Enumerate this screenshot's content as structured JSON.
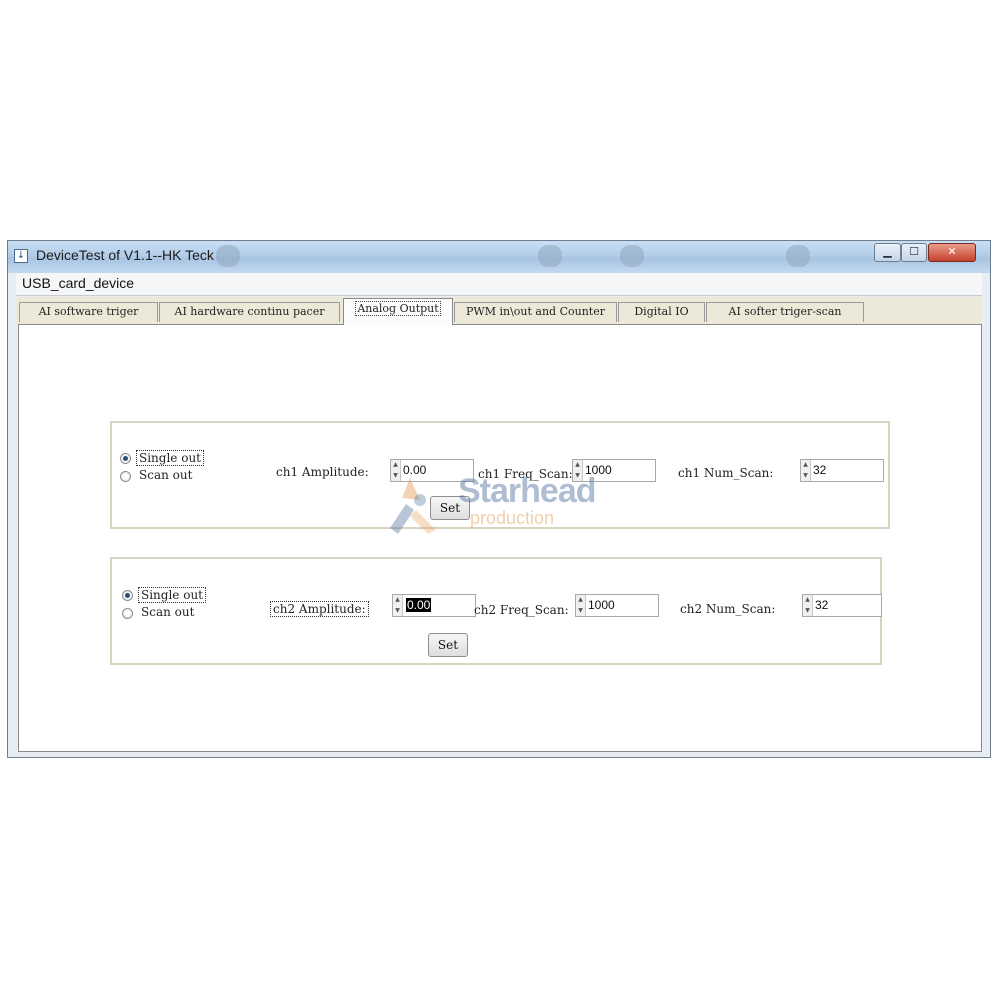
{
  "window": {
    "title": "DeviceTest of V1.1--HK Teck",
    "controls": {
      "minimize": "▁",
      "maximize": "☐",
      "close": "✕"
    }
  },
  "menu": {
    "items": [
      "USB_card_device"
    ]
  },
  "tabs": [
    {
      "label": "AI software triger",
      "active": false
    },
    {
      "label": "AI hardware continu pacer",
      "active": false
    },
    {
      "label": "Analog Output",
      "active": true
    },
    {
      "label": "PWM in\\out and Counter",
      "active": false
    },
    {
      "label": "Digital IO",
      "active": false
    },
    {
      "label": "AI softer triger-scan",
      "active": false
    }
  ],
  "ch1": {
    "radio_single": "Single out",
    "radio_scan": "Scan out",
    "selected_mode": "single",
    "amplitude_label": "ch1 Amplitude:",
    "amplitude_value": "0.00",
    "freq_label": "ch1 Freq_Scan:",
    "freq_value": "1000",
    "num_label": "ch1 Num_Scan:",
    "num_value": "32",
    "set_label": "Set"
  },
  "ch2": {
    "radio_single": "Single out",
    "radio_scan": "Scan out",
    "selected_mode": "single",
    "amplitude_label": "ch2 Amplitude:",
    "amplitude_value": "0.00",
    "freq_label": "ch2 Freq_Scan:",
    "freq_value": "1000",
    "num_label": "ch2 Num_Scan:",
    "num_value": "32",
    "set_label": "Set"
  },
  "watermark": {
    "text": "Starhead",
    "subtext": "production"
  },
  "colors": {
    "titlebar": "#b3cde8",
    "close_button": "#c5412b",
    "tab_strip": "#ece9d8",
    "group_border": "#d7d3c0"
  },
  "icons": {
    "window_icon": "app-window-icon",
    "spin_up": "spin-up-arrow-icon",
    "spin_down": "spin-down-arrow-icon"
  }
}
